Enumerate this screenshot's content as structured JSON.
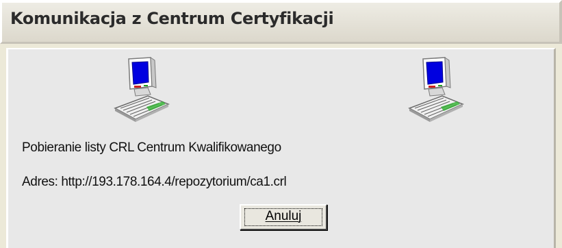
{
  "window": {
    "title": "Komunikacja z Centrum Certyfikacji"
  },
  "content": {
    "status_text": "Pobieranie listy CRL Centrum Kwalifikowanego",
    "address_text": "Adres: http://193.178.164.4/repozytorium/ca1.crl"
  },
  "buttons": {
    "cancel_label": "Anuluj"
  },
  "icons": {
    "source": "computer-icon",
    "destination": "computer-icon"
  }
}
